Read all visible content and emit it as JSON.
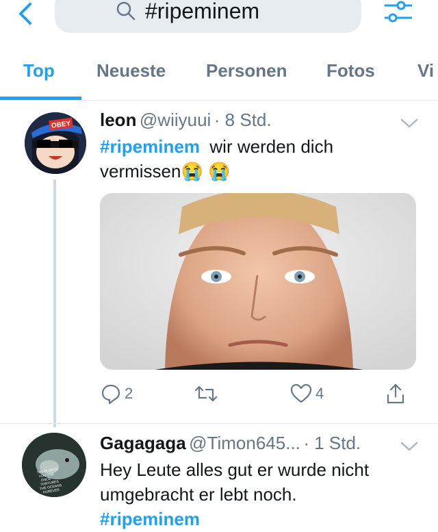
{
  "header": {
    "search_query": "#ripeminem",
    "back_icon": "back-chevron-icon",
    "filter_icon": "sliders-icon",
    "accent": "#1da1f2"
  },
  "tabs": [
    {
      "label": "Top",
      "active": true
    },
    {
      "label": "Neueste",
      "active": false
    },
    {
      "label": "Personen",
      "active": false
    },
    {
      "label": "Fotos",
      "active": false
    },
    {
      "label": "Vi",
      "active": false
    }
  ],
  "tweets": [
    {
      "name": "leon",
      "handle": "@wiiyuui",
      "time": "· 8 Std.",
      "hashtag": "#ripeminem",
      "text_after_hashtag": "wir werden dich",
      "text_line2": "vermissen",
      "emoji": "😭 😭",
      "avatar_badge": "OBEY",
      "actions": {
        "replies": "2",
        "likes": "4"
      }
    },
    {
      "name": "Gagagaga",
      "handle": "@Timon645...",
      "time": "· 1 Std.",
      "text_line1": "Hey Leute alles gut er wurde nicht",
      "text_line2": "umgebracht er lebt noch.",
      "hashtag": "#ripeminem",
      "avatar_caption": "THE PLASTIC YOU USE ONCE TORTURES THE OCEANS FOREVER"
    }
  ]
}
